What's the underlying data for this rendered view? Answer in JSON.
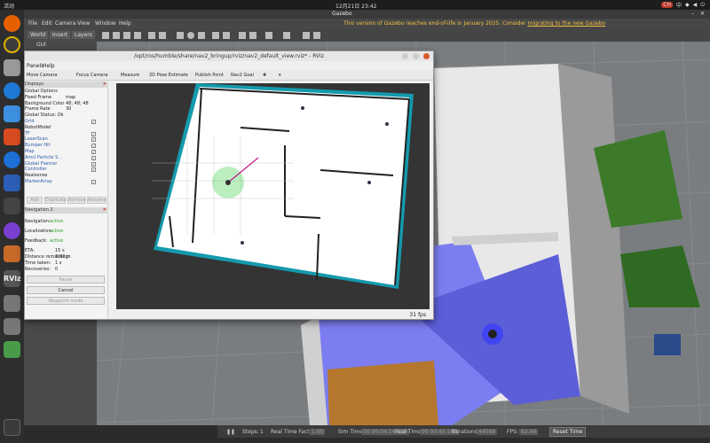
{
  "topbar": {
    "activities": "活动",
    "clock": "12月21日 23:42",
    "tray": [
      "CH",
      "中",
      "",
      "",
      "",
      "",
      "",
      ""
    ]
  },
  "gazebo": {
    "window_title": "Gazebo",
    "menu": [
      "File",
      "Edit",
      "Camera",
      "View",
      "Window",
      "Help"
    ],
    "warning_text": "This version of Gazebo reaches end-of-life in January 2025. Consider",
    "warning_link": "migrating to the new Gazebo",
    "left_tabs": [
      "World",
      "Insert",
      "Layers"
    ],
    "left_gui": "GUI",
    "bottom": {
      "steps_label": "Steps:",
      "steps_val": "1",
      "rtf_label": "Real Time Factor:",
      "rtf_val": "1.00",
      "sim_label": "Sim Time:",
      "sim_val": "00 00:04:14.339",
      "real_label": "Real Time:",
      "real_val": "00 00:45:169",
      "iter_label": "Iterations:",
      "iter_val": "44569",
      "fps_label": "FPS:",
      "fps_val": "62.46",
      "reset": "Reset Time"
    }
  },
  "dock": {
    "rviz_label": "RViz"
  },
  "rviz": {
    "title": "/opt/ros/humble/share/nav2_bringup/rviz/nav2_default_view.rviz* - RViz",
    "menu": [
      "Panels",
      "Help"
    ],
    "tools": [
      "Move Camera",
      "Focus Camera",
      "Measure",
      "2D Pose Estimate",
      "Publish Point",
      "Nav2 Goal"
    ],
    "displays_header": "Displays",
    "rows": [
      {
        "k": "Global Options",
        "v": "",
        "cb": "",
        "cls": ""
      },
      {
        "k": "Fixed Frame",
        "v": "map",
        "cb": "",
        "cls": ""
      },
      {
        "k": "Background Color",
        "v": "48; 48; 48",
        "cb": "",
        "cls": ""
      },
      {
        "k": "Frame Rate",
        "v": "30",
        "cb": "",
        "cls": ""
      },
      {
        "k": "Global Status: Ok",
        "v": "",
        "cb": "",
        "cls": ""
      },
      {
        "k": "Grid",
        "v": "",
        "cb": "✓",
        "cls": "blue"
      },
      {
        "k": "RobotModel",
        "v": "",
        "cb": "",
        "cls": ""
      },
      {
        "k": "TF",
        "v": "",
        "cb": "✓",
        "cls": "blue"
      },
      {
        "k": "LaserScan",
        "v": "",
        "cb": "✓",
        "cls": "blue"
      },
      {
        "k": "Bumper Hit",
        "v": "",
        "cb": "✓",
        "cls": "blue"
      },
      {
        "k": "Map",
        "v": "",
        "cb": "✓",
        "cls": "blue"
      },
      {
        "k": "Amcl Particle S...",
        "v": "",
        "cb": "✓",
        "cls": "blue"
      },
      {
        "k": "Global Planner",
        "v": "",
        "cb": "✓",
        "cls": "blue"
      },
      {
        "k": "Controller",
        "v": "",
        "cb": "✓",
        "cls": "blue"
      },
      {
        "k": "Realsense",
        "v": "",
        "cb": "",
        "cls": ""
      },
      {
        "k": "MarkerArray",
        "v": "",
        "cb": "✓",
        "cls": "blue"
      }
    ],
    "panel_buttons": [
      "Add",
      "Duplicate",
      "Remove",
      "Rename"
    ],
    "nav_header": "Navigation 2",
    "nav_rows": [
      {
        "k": "Navigation:",
        "v": "active"
      },
      {
        "k": "Localization:",
        "v": "active"
      },
      {
        "k": "Feedback:",
        "v": "active"
      }
    ],
    "nav_info": [
      {
        "k": "ETA:",
        "v": "15 s"
      },
      {
        "k": "Distance remaining:",
        "v": "3.02 m"
      },
      {
        "k": "Time taken:",
        "v": "1 s"
      },
      {
        "k": "Recoveries:",
        "v": "0"
      }
    ],
    "nav_buttons": [
      "Pause",
      "Cancel",
      "Waypoint mode"
    ],
    "fps": "31 fps"
  }
}
